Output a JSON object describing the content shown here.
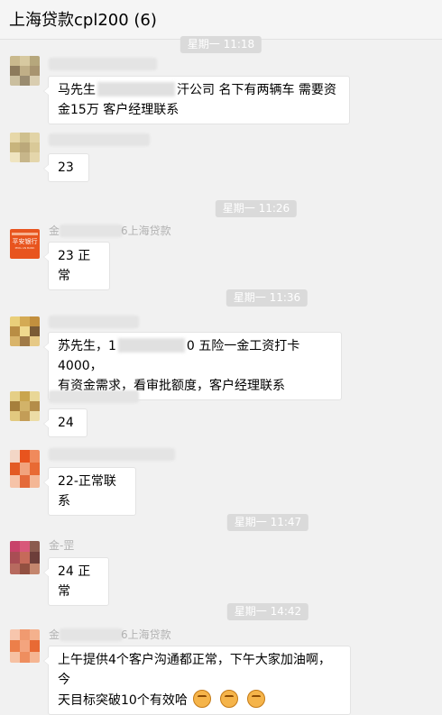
{
  "header": {
    "title": "上海贷款cpl200 (6)"
  },
  "times": [
    "星期一 11:18",
    "星期一 11:26",
    "星期一 11:36",
    "星期一 11:47",
    "星期一 14:42"
  ],
  "messages": [
    {
      "sender": "",
      "text_a": "马先生",
      "text_b": "汗公司 名下有两辆车 需要资",
      "text_c": "金15万 客户经理联系"
    },
    {
      "sender": "",
      "text": "23"
    },
    {
      "sender": "金",
      "sender_suffix": "6上海贷款",
      "text": "23 正常"
    },
    {
      "sender": "",
      "text_a": "苏先生，1",
      "text_b": "0 五险一金工资打卡4000，",
      "text_c": "有资金需求，看审批额度，客户经理联系"
    },
    {
      "sender": "",
      "text": "24"
    },
    {
      "sender": "",
      "text": "22-正常联系"
    },
    {
      "sender": "金-罡",
      "text": "24 正常"
    },
    {
      "sender": "金",
      "sender_suffix": "6上海贷款",
      "text_a": "上午提供4个客户沟通都正常，下午大家加油啊，今",
      "text_b": "天目标突破10个有效哈"
    }
  ],
  "avatars": {
    "bank_logo_text": "平安银行",
    "bank_logo_sub": "PING AN BANK"
  },
  "colors": {
    "bank_orange": "#e8541e",
    "background": "#f1f1f1",
    "timestamp_bg": "#dadada"
  }
}
